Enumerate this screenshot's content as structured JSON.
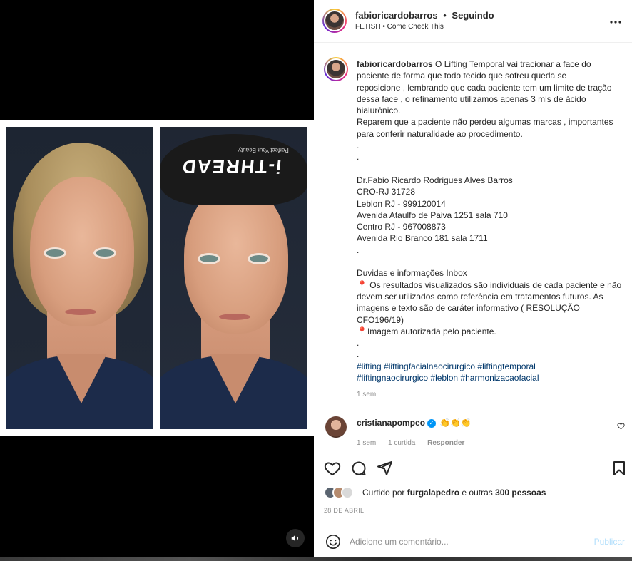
{
  "header": {
    "username": "fabioricardobarros",
    "separator": "•",
    "follow_state": "Seguindo",
    "music": "FETISH • Come Check This",
    "more_icon": "more-horizontal-icon"
  },
  "media": {
    "band_text": "i-THREAD",
    "band_sub": "Perfect Your Beauty",
    "mute_icon": "speaker-icon"
  },
  "caption": {
    "owner": "fabioricardobarros",
    "lines": [
      " O Lifting Temporal vai tracionar a face do",
      "paciente de forma que todo tecido que sofreu queda se",
      "reposicione , lembrando que cada paciente tem um limite de tração",
      "dessa face , o refinamento utilizamos apenas 3 mls de ácido",
      "hialurônico.",
      "Reparem que a paciente não perdeu algumas marcas , importantes",
      "para conferir naturalidade ao procedimento.",
      ".",
      ".",
      "",
      "Dr.Fabio Ricardo Rodrigues Alves Barros",
      "CRO-RJ 31728",
      "Leblon RJ - 999120014",
      "Avenida Ataulfo de Paiva 1251 sala 710",
      "Centro RJ - 967008873",
      "Avenida Rio Branco 181 sala 1711",
      ".",
      "",
      "Duvidas e informações Inbox",
      "📍 Os resultados visualizados são individuais de cada paciente e não",
      "devem ser utilizados como referência em tratamentos futuros. As",
      "imagens e texto são de caráter informativo ( RESOLUÇÃO",
      "CFO196/19)",
      "📍Imagem autorizada pelo paciente.",
      ".",
      "."
    ],
    "hashtags_line1": "#lifting #liftingfacialnaocirurgico #liftingtemporal",
    "hashtags_line2": "#liftingnaocirurgico #leblon #harmonizacaofacial",
    "time": "1 sem"
  },
  "comment": {
    "username": "cristianapompeo",
    "verified_icon": "verified-badge-icon",
    "text": "👏👏👏",
    "time": "1 sem",
    "likes": "1 curtida",
    "reply": "Responder"
  },
  "actions": {
    "like_icon": "heart-icon",
    "comment_icon": "comment-bubble-icon",
    "share_icon": "paper-plane-icon",
    "save_icon": "bookmark-icon"
  },
  "likes": {
    "prefix": "Curtido por ",
    "user": "furgalapedro",
    "suffix": " e outras ",
    "count": "300 pessoas"
  },
  "date": "28 DE ABRIL",
  "add_comment": {
    "placeholder": "Adicione um comentário...",
    "publish": "Publicar"
  },
  "colors": {
    "link": "#00376b",
    "muted": "#8e8e8e",
    "publish_disabled": "#b2dffc",
    "verified": "#0095f6"
  }
}
